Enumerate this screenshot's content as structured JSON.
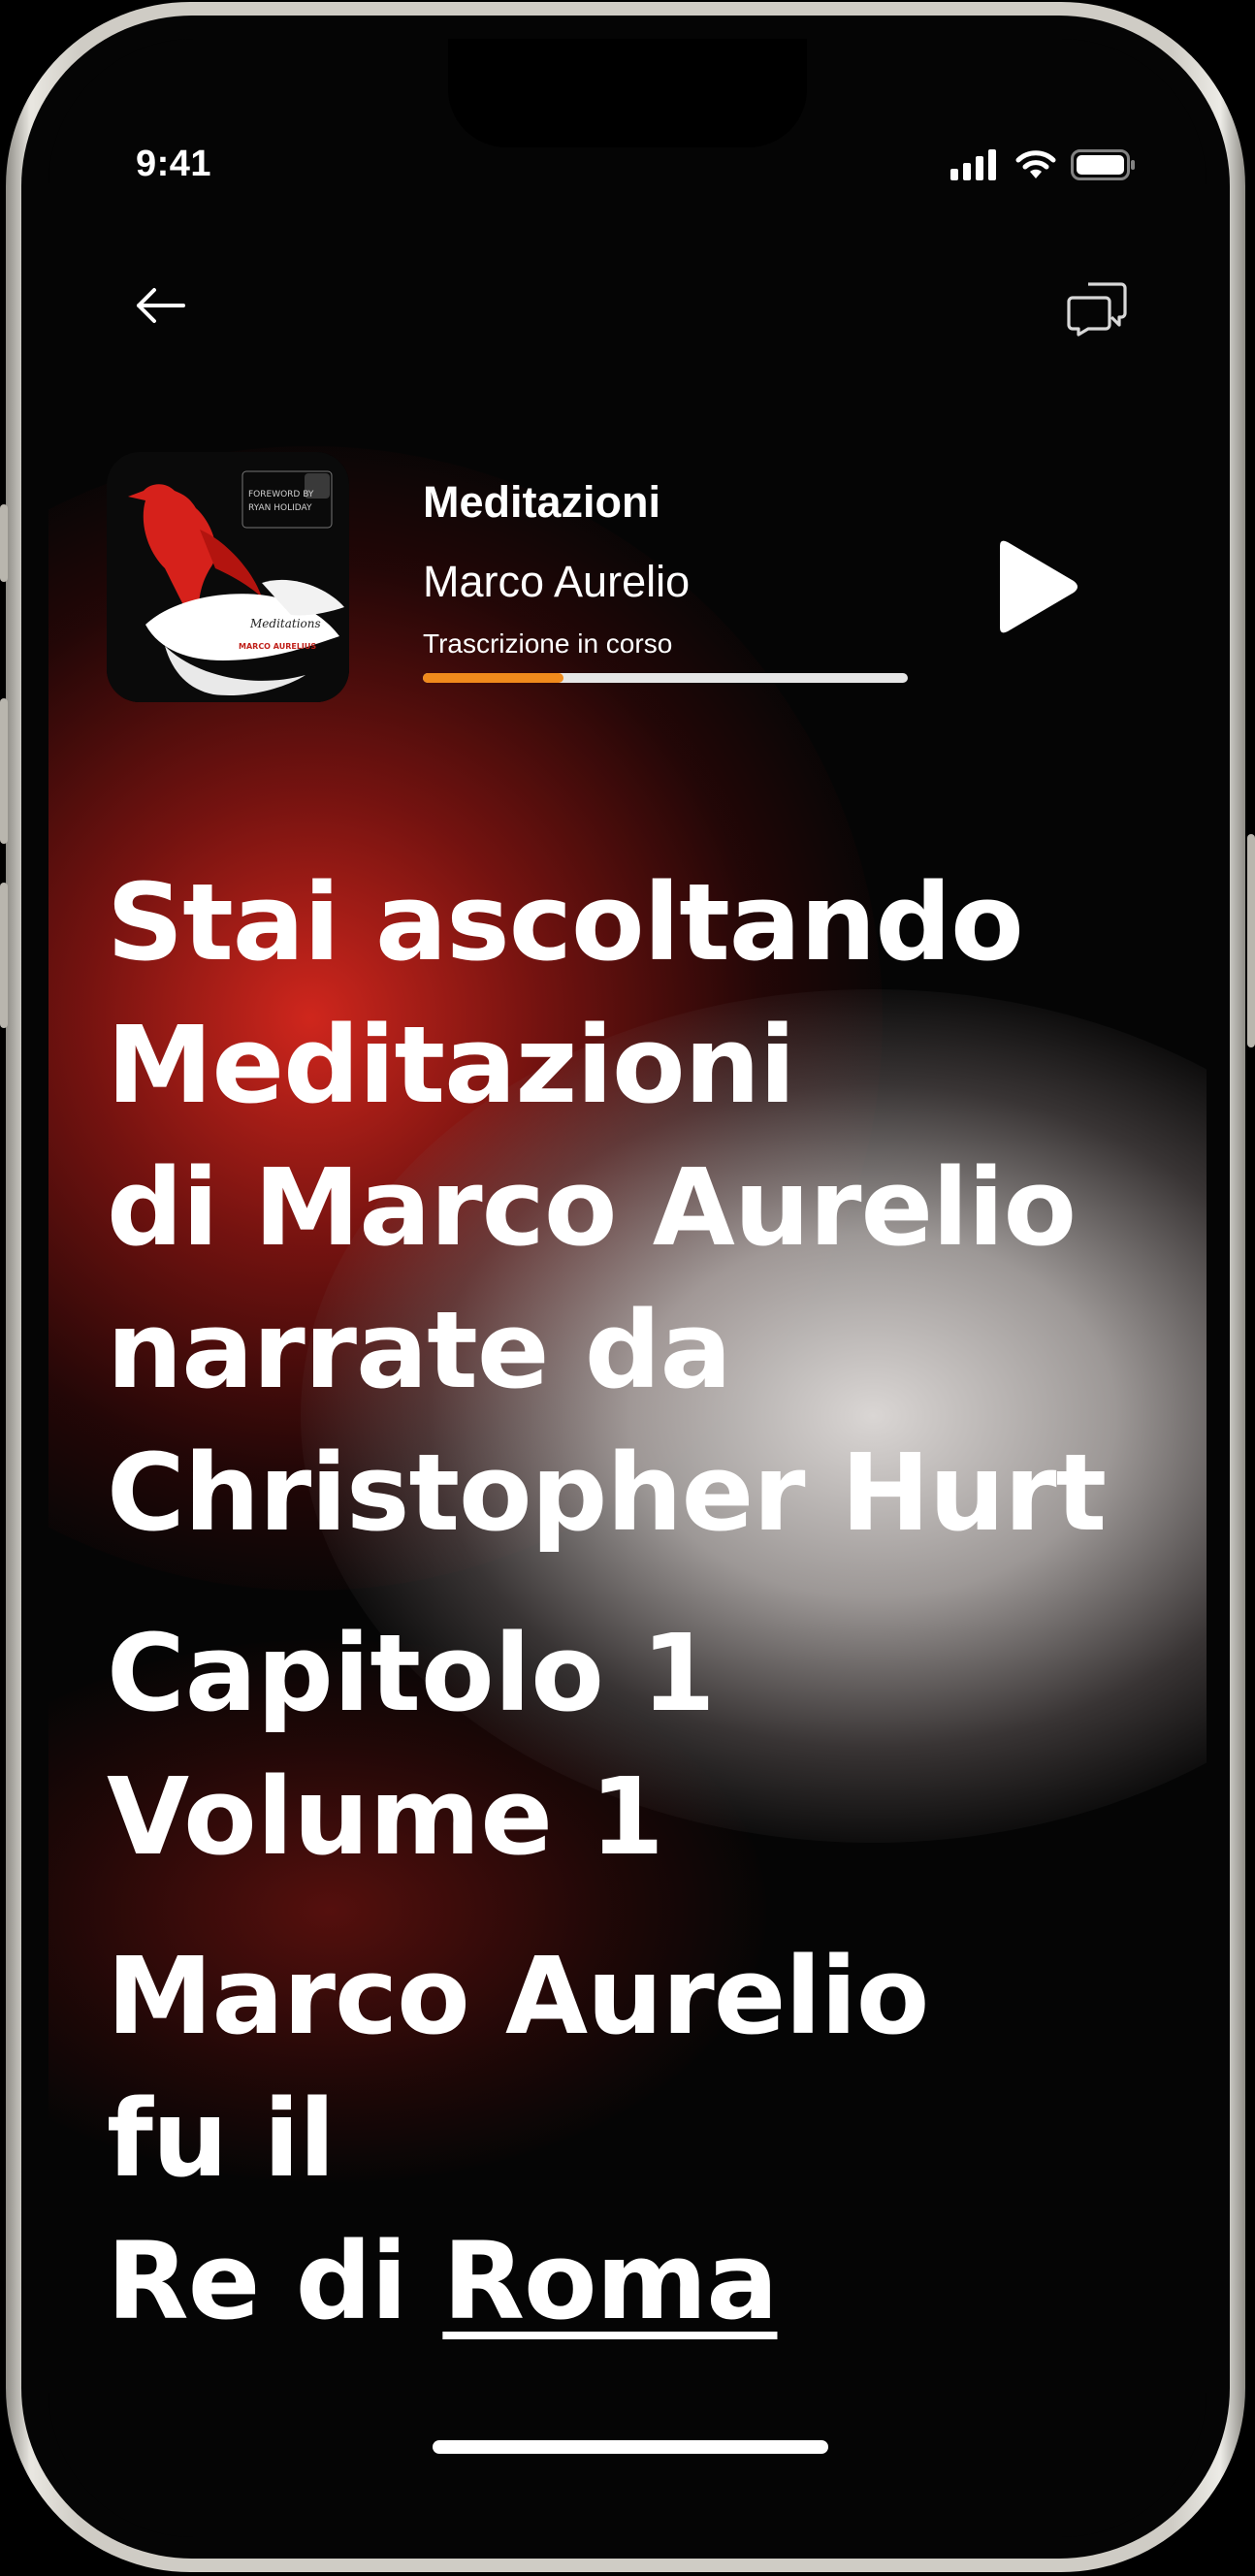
{
  "status_bar": {
    "time": "9:41"
  },
  "header": {
    "back_icon": "arrow-left-icon",
    "chat_icon": "chat-bubbles-icon"
  },
  "now_playing": {
    "title": "Meditazioni",
    "author": "Marco Aurelio",
    "status": "Trascrizione in corso",
    "progress": 0.29,
    "play_icon": "play-icon",
    "cover": {
      "top_text_1": "FOREWORD BY",
      "top_text_2": "RYAN HOLIDAY",
      "title": "Meditations",
      "author": "MARCO AURELIUS"
    }
  },
  "transcript": {
    "intro": [
      "Stai ascoltando",
      "Meditazioni",
      "di Marco Aurelio",
      "narrate da",
      "Christopher Hurt"
    ],
    "chapter": "Capitolo 1 Volume 1",
    "sentence": [
      "Marco Aurelio",
      "fu il"
    ],
    "last_line_prefix": "Re di ",
    "current_word": "Roma"
  },
  "colors": {
    "accent": "#f08a1c",
    "glow_red": "#da281e",
    "glow_white": "#dedad8"
  }
}
